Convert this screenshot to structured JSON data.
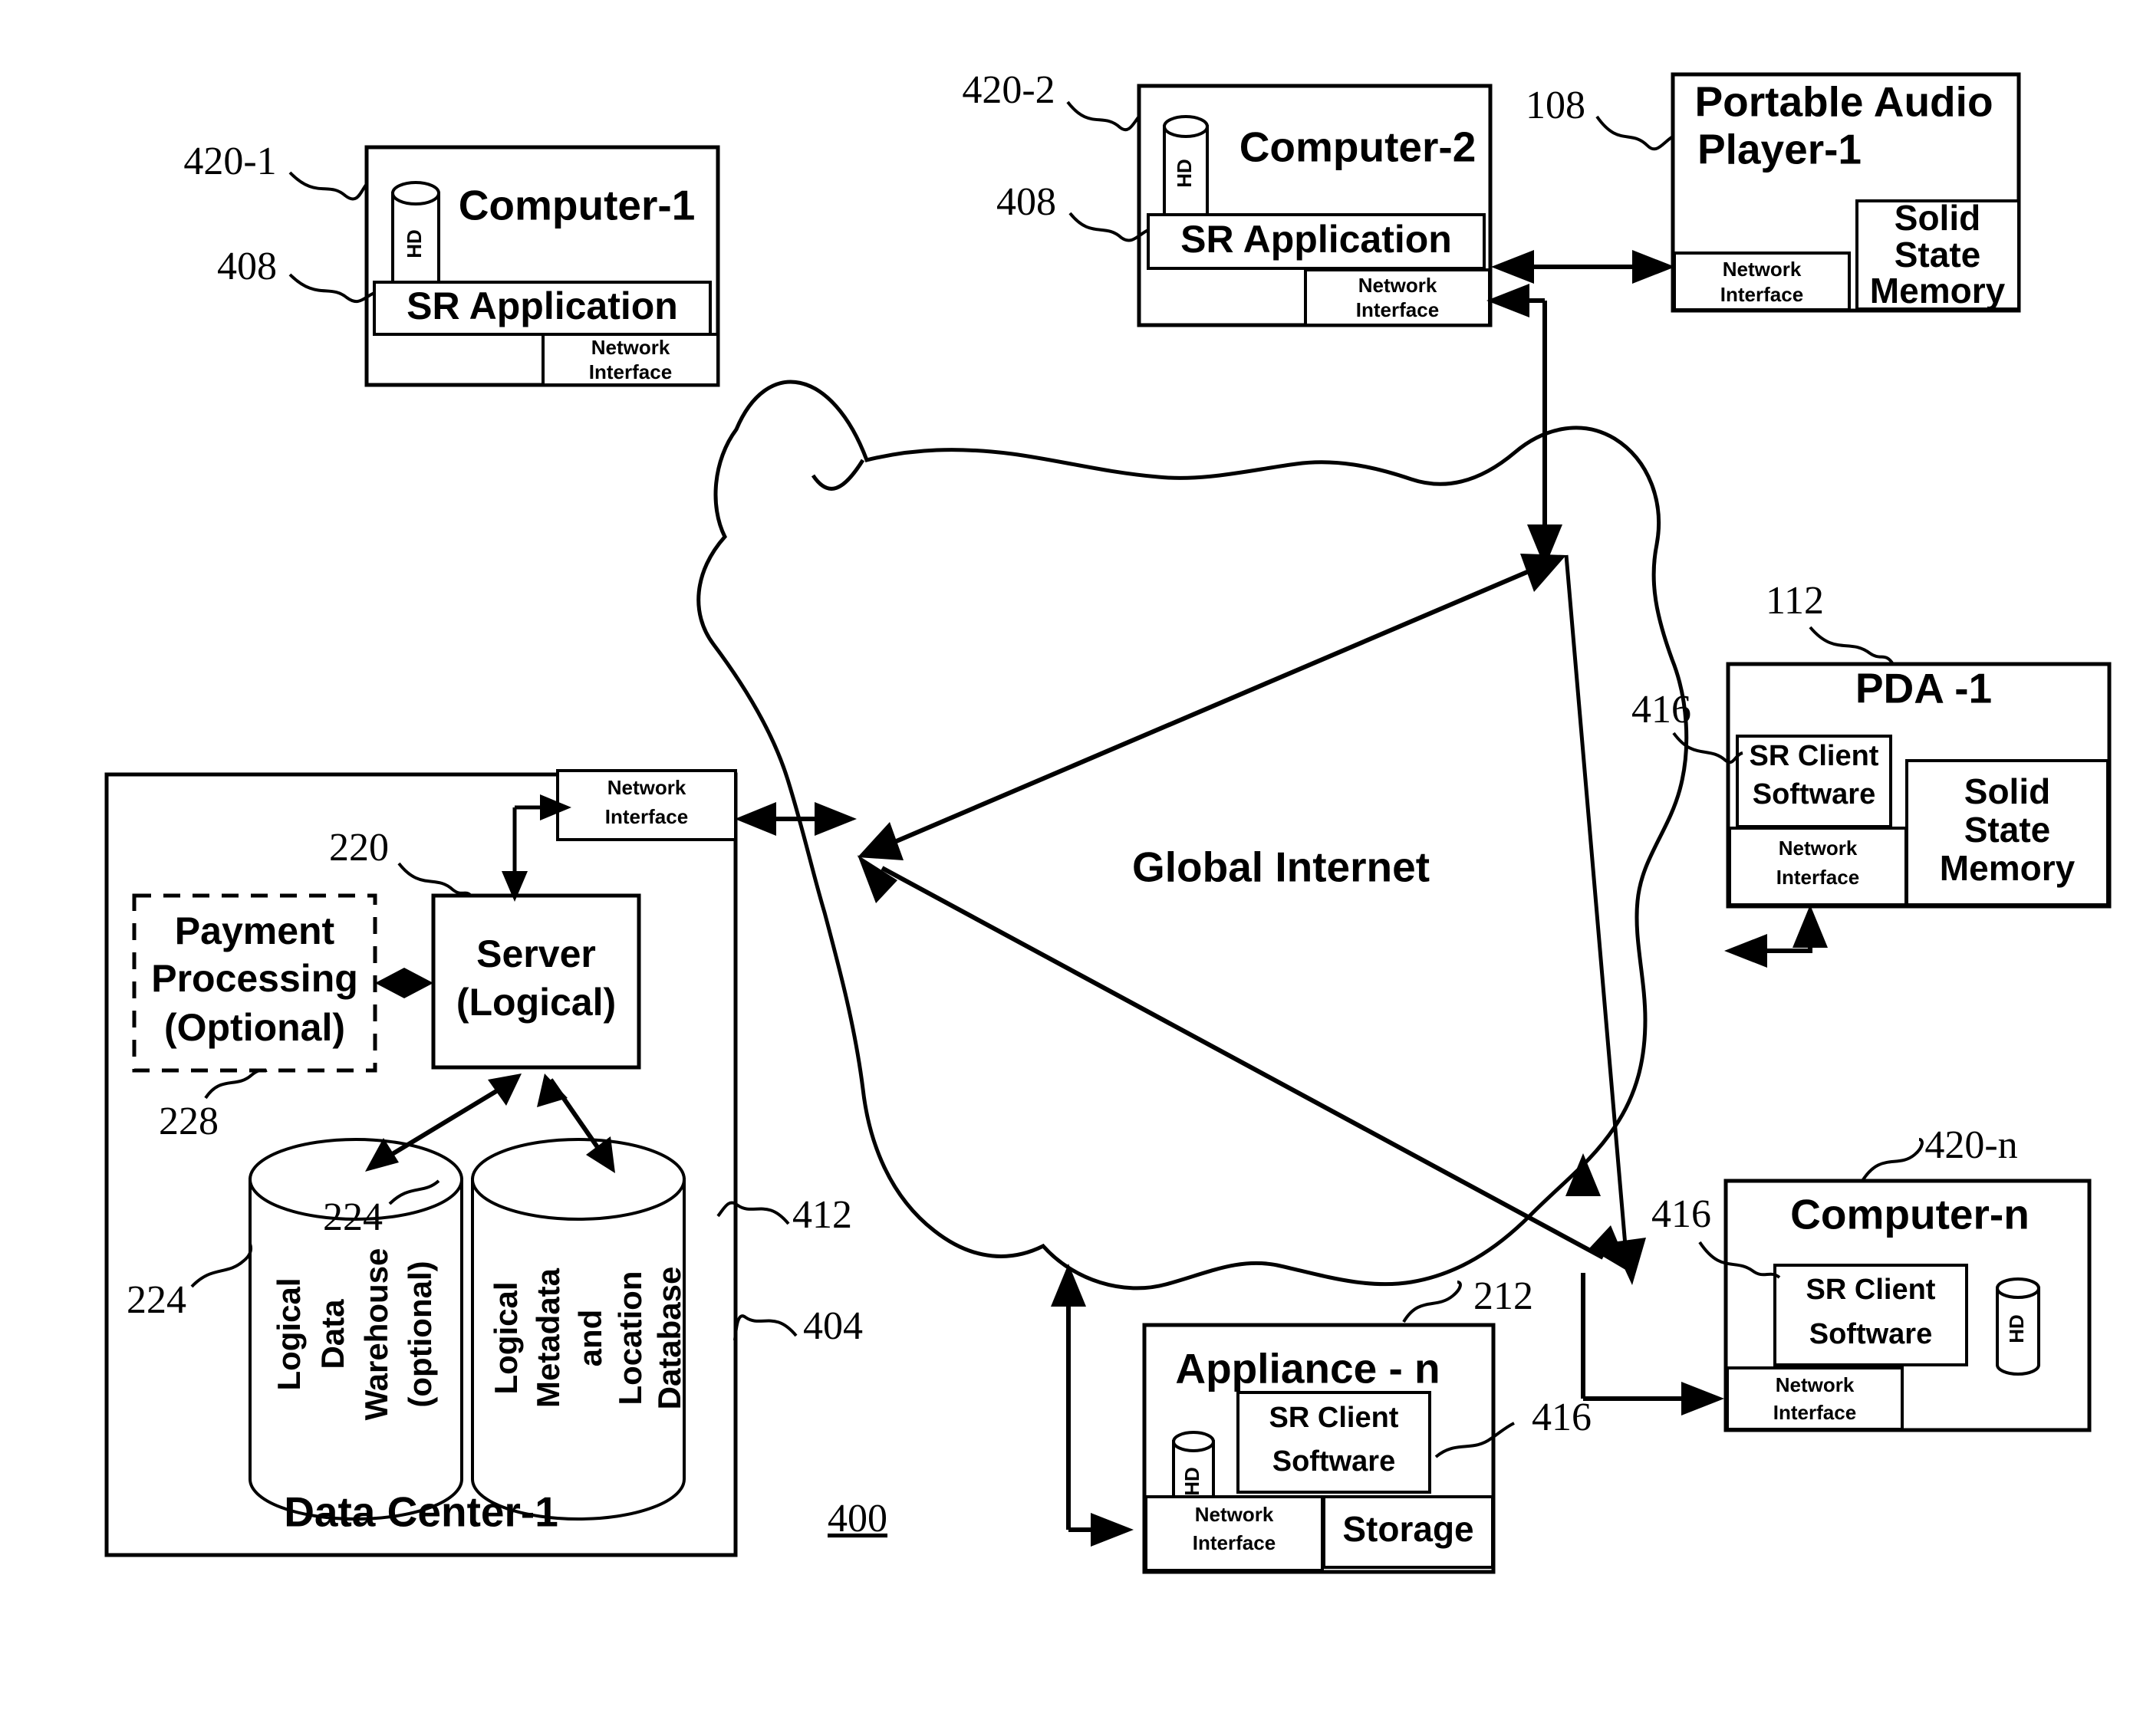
{
  "figure": {
    "number": "400",
    "network_cloud_label": "Global Internet"
  },
  "labels": {
    "network_interface": "Network\nInterface",
    "network_interface_line1": "Network",
    "network_interface_line2": "Interface",
    "sr_application": "SR Application",
    "sr_client_software_line1": "SR Client",
    "sr_client_software_line2": "Software",
    "solid_state_memory_line1": "Solid",
    "solid_state_memory_line2": "State",
    "solid_state_memory_line3": "Memory",
    "hard_disk": "HD",
    "storage": "Storage"
  },
  "nodes": {
    "computer_1": {
      "title": "Computer-1",
      "ref": "420-1",
      "app_ref": "408",
      "app_label": "SR Application",
      "disk_label": "HD",
      "nic_line1": "Network",
      "nic_line2": "Interface"
    },
    "computer_2": {
      "title": "Computer-2",
      "ref": "420-2",
      "app_ref": "408",
      "app_label": "SR Application",
      "disk_label": "HD",
      "nic_line1": "Network",
      "nic_line2": "Interface"
    },
    "portable_audio_player_1": {
      "title_line1": "Portable Audio",
      "title_line2": "Player-1",
      "ref": "108",
      "nic_line1": "Network",
      "nic_line2": "Interface",
      "memory_line1": "Solid",
      "memory_line2": "State",
      "memory_line3": "Memory"
    },
    "pda_1": {
      "title": "PDA -1",
      "ref": "112",
      "client_ref": "416",
      "client_line1": "SR Client",
      "client_line2": "Software",
      "nic_line1": "Network",
      "nic_line2": "Interface",
      "memory_line1": "Solid",
      "memory_line2": "State",
      "memory_line3": "Memory"
    },
    "computer_n": {
      "title": "Computer-n",
      "ref": "420-n",
      "client_ref": "416",
      "client_line1": "SR Client",
      "client_line2": "Software",
      "disk_label": "HD",
      "nic_line1": "Network",
      "nic_line2": "Interface"
    },
    "appliance_n": {
      "title": "Appliance - n",
      "ref": "212",
      "client_ref": "416",
      "client_line1": "SR Client",
      "client_line2": "Software",
      "disk_label": "HD",
      "nic_line1": "Network",
      "nic_line2": "Interface",
      "storage_label": "Storage"
    },
    "data_center_1": {
      "title": "Data Center-1",
      "ref": "404",
      "nic_line1": "Network",
      "nic_line2": "Interface",
      "nic_ref": "412",
      "server_line1": "Server",
      "server_line2": "(Logical)",
      "server_ref": "220",
      "payment_line1": "Payment",
      "payment_line2": "Processing",
      "payment_line3": "(Optional)",
      "payment_ref": "228",
      "warehouse_line1": "Logical",
      "warehouse_line2": "Data",
      "warehouse_line3": "Warehouse",
      "warehouse_line4": "(optional)",
      "warehouse_ref_left": "224",
      "warehouse_ref_inner": "224",
      "metadata_line1": "Logical",
      "metadata_line2": "Metadata",
      "metadata_line3": "and",
      "metadata_line4": "Location",
      "metadata_line5": "Database"
    }
  },
  "reference_numerals": [
    "420-1",
    "408",
    "420-2",
    "408",
    "108",
    "112",
    "416",
    "220",
    "228",
    "224",
    "224",
    "412",
    "404",
    "400",
    "212",
    "416",
    "416",
    "420-n"
  ],
  "colors": {
    "stroke": "#000000",
    "fill": "#ffffff",
    "text": "#000000"
  }
}
